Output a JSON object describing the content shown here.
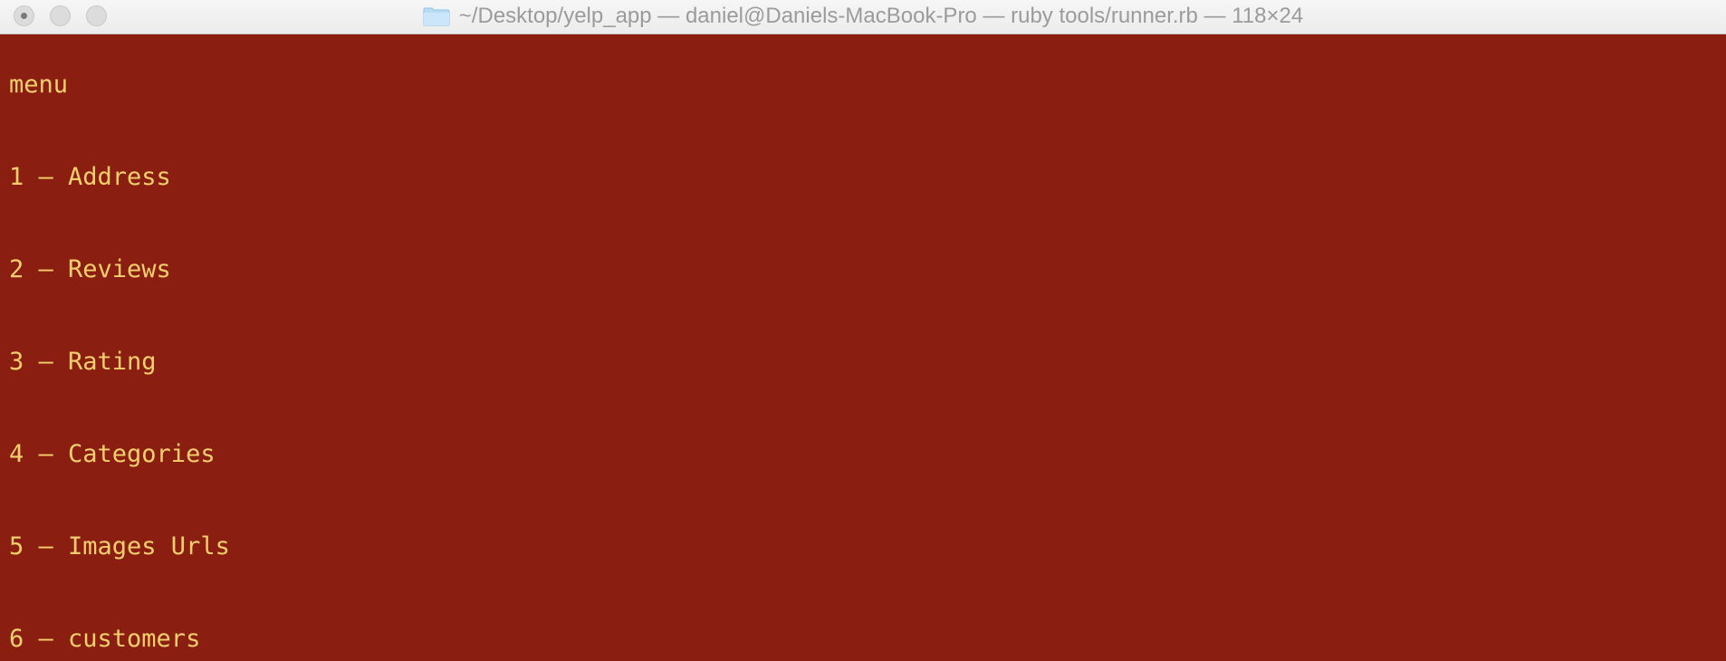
{
  "window": {
    "title": "~/Desktop/yelp_app — daniel@Daniels-MacBook-Pro — ruby tools/runner.rb — 118×24",
    "folder_icon": "folder-icon"
  },
  "terminal": {
    "background_color": "#8a1f11",
    "text_color": "#f5cf6e",
    "lines": [
      "menu",
      "1 – Address",
      "2 – Reviews",
      "3 – Rating",
      "4 – Categories",
      "5 – Images Urls",
      "6 – customers"
    ]
  }
}
